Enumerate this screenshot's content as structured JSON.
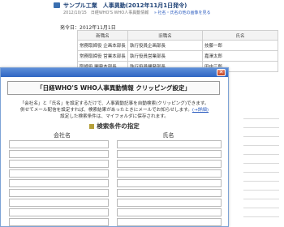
{
  "article": {
    "title": "サンプル工業　人事異動(2012年11月1日発令)",
    "subtitle": "2012/10/15　日経WHO'S WHO人事異動情報　",
    "subtitle_link": "» 社名・氏名の他の画像を見る",
    "date_line": "発令日：2012年11月1日",
    "table": {
      "headers": [
        "新職名",
        "旧職名",
        "氏名"
      ],
      "rows": [
        [
          "常務取締役 企画本部長",
          "執行役員企画部長",
          "技藤一郎"
        ],
        [
          "常務取締役 営業本部長",
          "執行役員営業部長",
          "嘉澤太郎"
        ],
        [
          "取締役 開発本部長",
          "執行役員開発部長",
          "田中三郎"
        ]
      ]
    }
  },
  "dialog": {
    "close_glyph": "✕",
    "heading": "「日経WHO'S WHO人事異動情報 クリッピング設定」",
    "description": [
      "「会社名」と「氏名」を設定するだけで、人事異動記事を自動検索(クリッピング)できます。",
      "併せてメール配信を設定すれば、検索結果があったときにメールでお知らせします。",
      "設定した検索条件は、マイフォルダに保存されます。"
    ],
    "description_link": "(→詳細)",
    "section_title": "検索条件の指定",
    "columns": [
      "会社名",
      "氏名"
    ],
    "rows": [
      {
        "company": "",
        "name": ""
      },
      {
        "company": "",
        "name": ""
      },
      {
        "company": "",
        "name": ""
      },
      {
        "company": "",
        "name": ""
      },
      {
        "company": "",
        "name": ""
      },
      {
        "company": "",
        "name": ""
      },
      {
        "company": "",
        "name": ""
      },
      {
        "company": "",
        "name": ""
      },
      {
        "company": "",
        "name": ""
      },
      {
        "company": "",
        "name": ""
      }
    ]
  }
}
